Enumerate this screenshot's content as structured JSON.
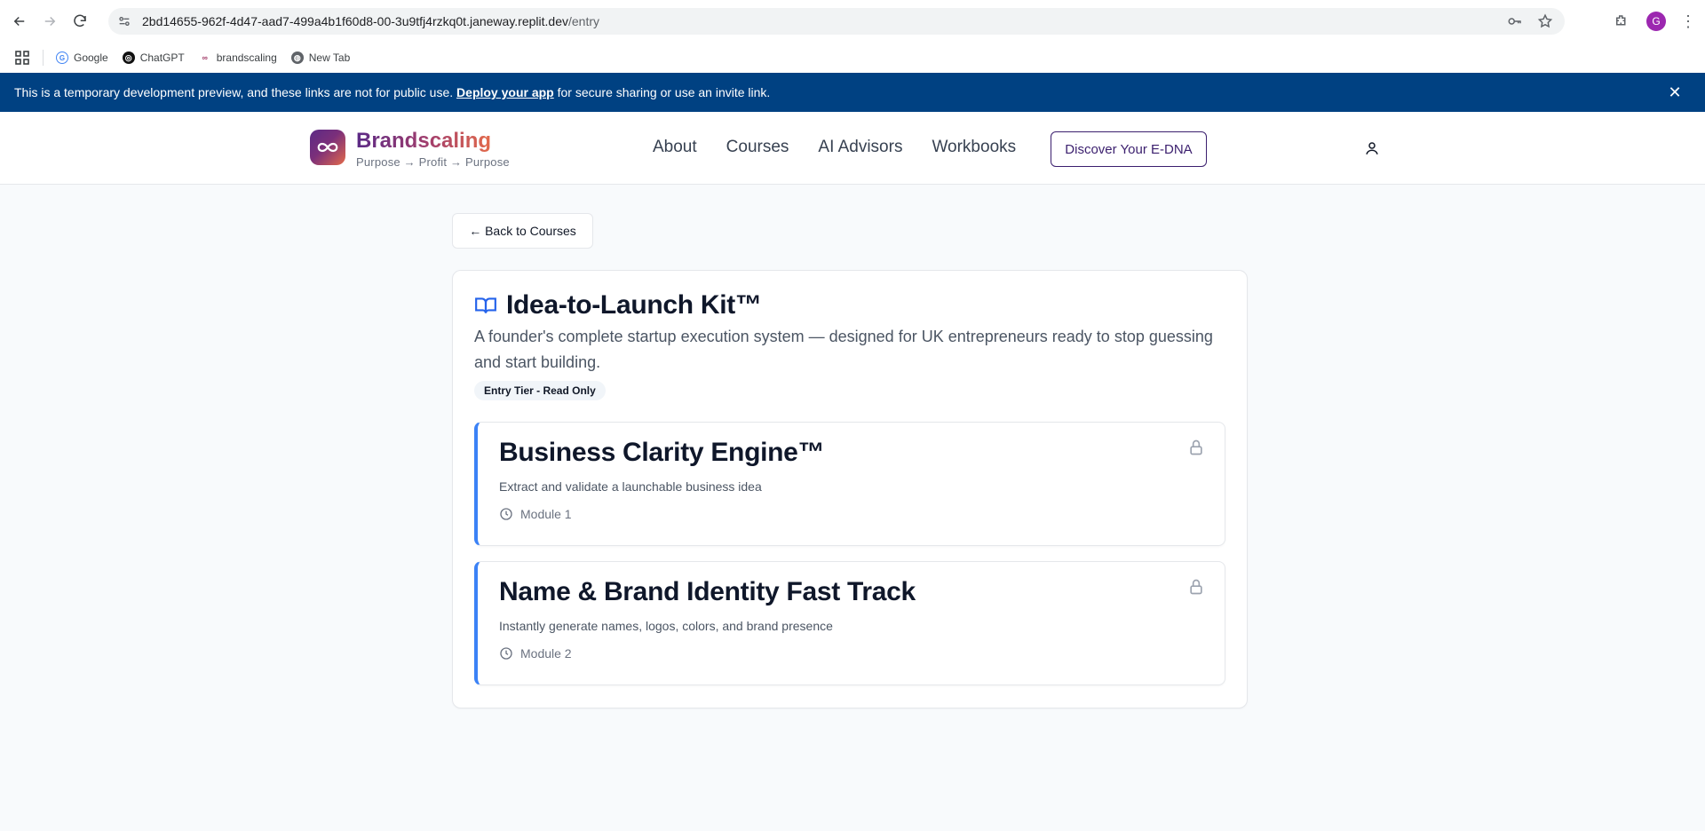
{
  "browser": {
    "url_host": "2bd14655-962f-4d47-aad7-499a4b1f60d8-00-3u9tfj4rzkq0t.janeway.replit.dev",
    "url_path": "/entry",
    "profile_initial": "G",
    "bookmarks": [
      {
        "label": "Google",
        "icon": "google-icon"
      },
      {
        "label": "ChatGPT",
        "icon": "chatgpt-icon"
      },
      {
        "label": "brandscaling",
        "icon": "brandscaling-icon"
      },
      {
        "label": "New Tab",
        "icon": "globe-icon"
      }
    ]
  },
  "dev_banner": {
    "text_before": "This is a temporary development preview, and these links are not for public use. ",
    "link": "Deploy your app",
    "text_after": " for secure sharing or use an invite link."
  },
  "header": {
    "brand_name": "Brandscaling",
    "tagline": "Purpose → Profit → Purpose",
    "nav": [
      "About",
      "Courses",
      "AI Advisors",
      "Workbooks"
    ],
    "cta": "Discover Your E-DNA"
  },
  "page": {
    "back_label": "← Back to Courses",
    "course": {
      "title": "Idea-to-Launch Kit™",
      "description": "A founder's complete startup execution system — designed for UK entrepreneurs ready to stop guessing and start building.",
      "tier_badge": "Entry Tier - Read Only",
      "modules": [
        {
          "title": "Business Clarity Engine™",
          "subtitle": "Extract and validate a launchable business idea",
          "meta": "Module 1",
          "locked": true
        },
        {
          "title": "Name & Brand Identity Fast Track",
          "subtitle": "Instantly generate names, logos, colors, and brand presence",
          "meta": "Module 2",
          "locked": true
        }
      ]
    }
  },
  "colors": {
    "banner_bg": "#004182",
    "accent_blue": "#3b82f6",
    "brand_purple": "#5b2a86",
    "brand_orange": "#e36a4a"
  }
}
